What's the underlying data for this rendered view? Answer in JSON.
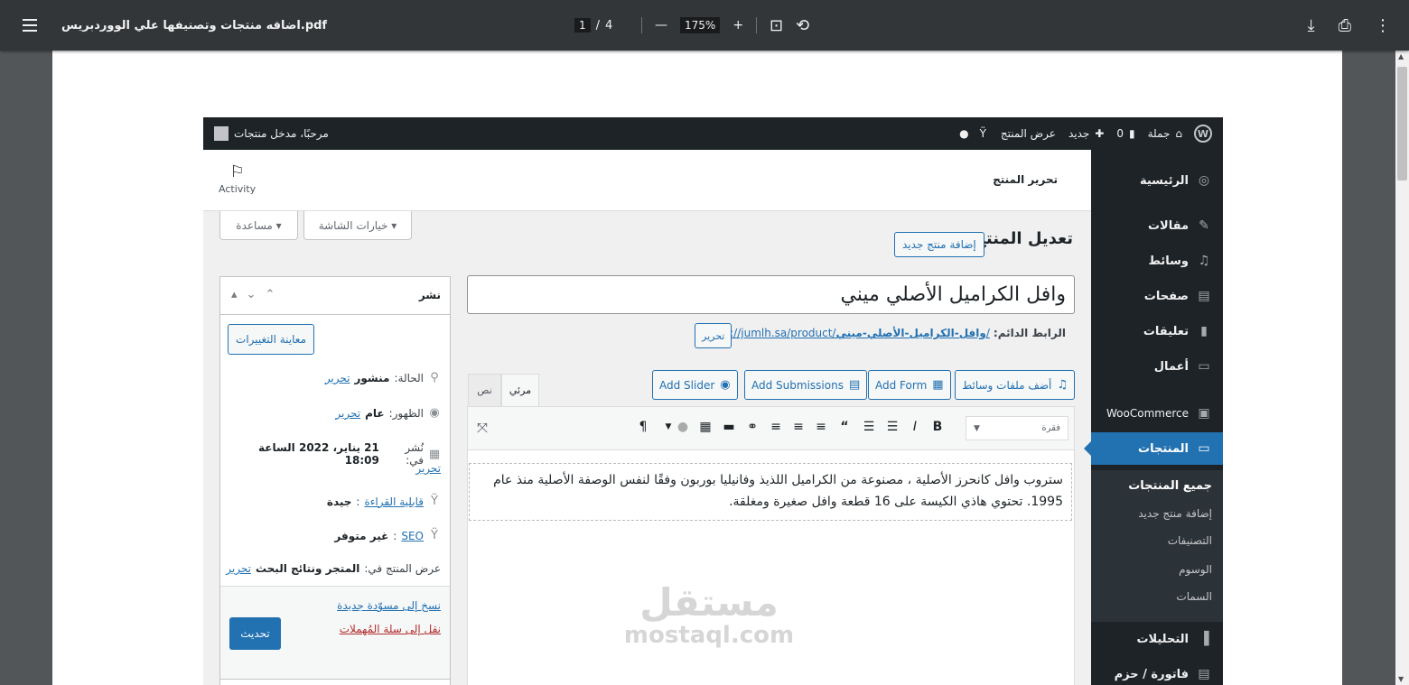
{
  "viewer": {
    "file_title": "اضافه منتجات وتصنيفها علي الووردبريس.pdf",
    "page_current": "1",
    "page_sep": "/",
    "page_total": "4",
    "zoom_minus": "—",
    "zoom_value": "175%",
    "zoom_plus": "+"
  },
  "adminbar": {
    "site_name": "جملة",
    "comments_count": "0",
    "new_label": "جديد",
    "view_product": "عرض المنتج",
    "greeting": "مرحبًا، مدخل منتجات"
  },
  "sidebar": {
    "items": [
      {
        "label": "الرئيسية",
        "icon": "dashboard-icon"
      },
      {
        "label": "مقالات",
        "icon": "pin-icon"
      },
      {
        "label": "وسائط",
        "icon": "media-icon"
      },
      {
        "label": "صفحات",
        "icon": "pages-icon"
      },
      {
        "label": "تعليقات",
        "icon": "comments-icon"
      },
      {
        "label": "أعمال",
        "icon": "folder-icon"
      },
      {
        "label": "WooCommerce",
        "icon": "woo-icon"
      },
      {
        "label": "المنتجات",
        "icon": "products-icon"
      },
      {
        "label": "التحليلات",
        "icon": "analytics-icon"
      },
      {
        "label": "فاتورة / حزم",
        "icon": "invoice-icon"
      }
    ],
    "submenu": [
      "جميع المنتجات",
      "إضافة منتج جديد",
      "التصنيفات",
      "الوسوم",
      "السمات"
    ]
  },
  "header": {
    "activity_label": "Activity",
    "edit_product_small": "تحرير المنتج",
    "screen_options": "خيارات الشاشة ▾",
    "help": "مساعدة ▾",
    "page_title": "تعديل المنتج",
    "add_new": "إضافة منتج جديد"
  },
  "product": {
    "title": "وافل الكراميل الأصلي ميني",
    "permalink_label": "الرابط الدائم:",
    "permalink_base": "https://jumlh.sa/product/",
    "permalink_slug": "وافل-الكراميل-الأصلي-ميني",
    "permalink_end": "/",
    "permalink_edit": "تحرير",
    "content": "ستروب وافل كانحرز الأصلية ، مصنوعة من الكراميل اللذيذ وفانيليا بوربون وفقًا لنفس الوصفة الأصلية منذ عام 1995. تحتوي هاذي الكيسة على 16 قطعة وافل صغيرة ومغلقة."
  },
  "media_buttons": {
    "add_media": "أضف ملفات وسائط",
    "add_form": "Add Form",
    "add_submissions": "Add Submissions",
    "add_slider": "Add Slider"
  },
  "editor_tabs": {
    "visual": "مرئي",
    "text": "نص"
  },
  "format_select": "فقرة",
  "publish": {
    "title": "نشر",
    "preview": "معاينة التغييرات",
    "status_label": "الحالة:",
    "status_value": "منشور",
    "visibility_label": "الظهور:",
    "visibility_value": "عام",
    "published_label": "نُشر في:",
    "published_value": "21 يناير، 2022 الساعة 18:09",
    "edit": "تحرير",
    "readability_label": "قابلية القراءة",
    "readability_value": "جيدة",
    "seo_label": "SEO",
    "seo_value": "غير متوفر",
    "catalog_label": "عرض المنتج في:",
    "catalog_value": "المتجر ونتائج البحث",
    "copy_draft": "نسخ إلى مسوّدة جديدة",
    "trash": "نقل إلى سلة المُهملات",
    "update": "تحديث"
  },
  "watermark": {
    "ar": "مستقل",
    "en": "mostaql.com"
  },
  "colors": {
    "accent": "#2271b1",
    "adminbar": "#1d2327",
    "viewer_toolbar": "#323639"
  }
}
